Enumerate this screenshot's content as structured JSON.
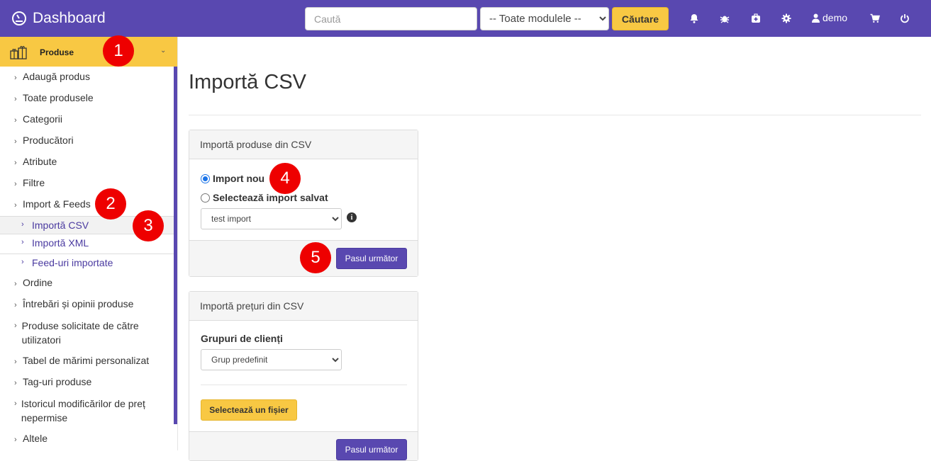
{
  "header": {
    "title": "Dashboard",
    "search_placeholder": "Caută",
    "module_select": "-- Toate modulele --",
    "search_button": "Căutare",
    "user": "demo"
  },
  "sidebar": {
    "section": "Produse",
    "items": [
      "Adaugă produs",
      "Toate produsele",
      "Categorii",
      "Producători",
      "Atribute",
      "Filtre",
      "Import & Feeds",
      "Ordine",
      "Întrebări și opinii produse",
      "Produse solicitate de către utilizatori",
      "Tabel de mărimi personalizat",
      "Tag-uri produse",
      "Istoricul modificărilor de preț nepermise",
      "Altele"
    ],
    "sub_items": [
      "Importă CSV",
      "Importă XML",
      "Feed-uri importate"
    ]
  },
  "badges": [
    "1",
    "2",
    "3",
    "4",
    "5"
  ],
  "main": {
    "title": "Importă CSV",
    "panel1": {
      "title": "Importă produse din CSV",
      "radio_new": "Import nou",
      "radio_saved": "Selectează import salvat",
      "saved_select": "test import",
      "next_button": "Pasul următor"
    },
    "panel2": {
      "title": "Importă prețuri din CSV",
      "group_label": "Grupuri de clienți",
      "group_select": "Grup predefinit",
      "file_button": "Selectează un fișier",
      "next_button": "Pasul următor"
    }
  }
}
